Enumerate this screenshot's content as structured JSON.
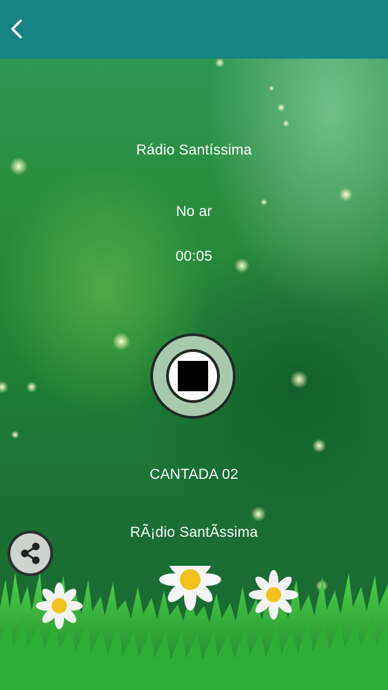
{
  "header": {
    "back_icon": "chevron-left-icon"
  },
  "player": {
    "station_name": "Rádio Santíssima",
    "status": "No ar",
    "elapsed": "00:05",
    "control_icon": "stop-icon",
    "track_title": "CANTADA 02",
    "track_artist": "RÃ¡dio SantÃssima"
  },
  "share": {
    "icon": "share-icon"
  },
  "colors": {
    "header": "#168384",
    "background": "#1f7a3a",
    "button_ring": "#a8c9ad"
  }
}
